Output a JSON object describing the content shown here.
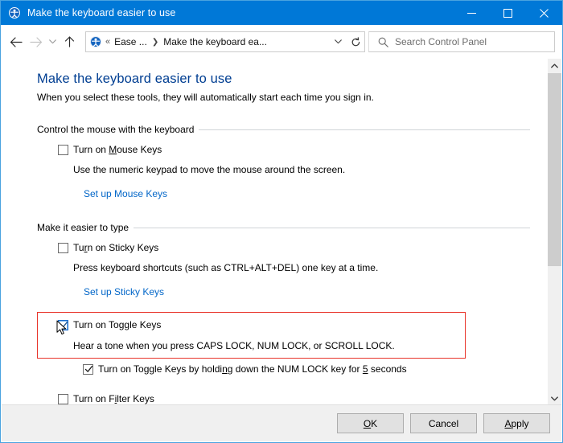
{
  "window": {
    "title": "Make the keyboard easier to use",
    "title_icon": "ease-of-access-icon",
    "minimize_label": "─",
    "maximize_label": "□",
    "close_label": "✕",
    "accent_color": "#0078d7",
    "border_color": "#4aa3e0"
  },
  "navigation": {
    "back_icon": "back-arrow-icon",
    "forward_icon": "forward-arrow-icon",
    "recent_icon": "chevron-down-icon",
    "up_icon": "up-arrow-icon",
    "address": {
      "icon": "ease-of-access-icon",
      "overflow_chevrons": "«",
      "crumbs": [
        "Ease ...",
        "Make the keyboard ea..."
      ],
      "separator": "❯",
      "dropdown_icon": "chevron-down-icon",
      "refresh_icon": "refresh-icon"
    },
    "search": {
      "icon": "search-icon",
      "placeholder": "Search Control Panel",
      "value": ""
    }
  },
  "page": {
    "heading": "Make the keyboard easier to use",
    "subheading": "When you select these tools, they will automatically start each time you sign in.",
    "heading_color": "#003e92",
    "link_color": "#0266c8"
  },
  "sections": [
    {
      "title": "Control the mouse with the keyboard",
      "checkbox": {
        "label_pre": "Turn on ",
        "label_accel": "M",
        "label_post": "ouse Keys",
        "checked": false
      },
      "description": "Use the numeric keypad to move the mouse around the screen.",
      "link": "Set up Mouse Keys"
    },
    {
      "title": "Make it easier to type",
      "checkbox": {
        "label_pre": "Tu",
        "label_accel": "r",
        "label_post": "n on Sticky Keys",
        "checked": false
      },
      "description": "Press keyboard shortcuts (such as CTRL+ALT+DEL) one key at a time.",
      "link": "Set up Sticky Keys"
    }
  ],
  "toggle_keys": {
    "checkbox": {
      "label_pre": "Turn on To",
      "label_accel": "g",
      "label_post": "gle Keys",
      "checked": true,
      "focused": true
    },
    "description": "Hear a tone when you press CAPS LOCK, NUM LOCK, or SCROLL LOCK.",
    "sub_checkbox": {
      "label_pre": "Turn on Toggle Keys by holdi",
      "label_accel": "n",
      "label_mid": "g down the NUM LOCK key for ",
      "label_accel2": "5",
      "label_post": " seconds",
      "checked": true
    },
    "highlight_color": "#e8342a"
  },
  "filter_keys": {
    "checkbox": {
      "label_pre": "Turn on F",
      "label_accel": "i",
      "label_post": "lter Keys",
      "checked": false
    }
  },
  "scrollbar": {
    "up_icon": "scroll-up-arrow-icon",
    "down_icon": "scroll-down-arrow-icon",
    "thumb_name": "scroll-thumb"
  },
  "buttons": {
    "ok": {
      "pre": "",
      "accel": "O",
      "post": "K"
    },
    "cancel": {
      "pre": "Cancel",
      "accel": "",
      "post": ""
    },
    "apply": {
      "pre": "",
      "accel": "A",
      "post": "pply"
    }
  }
}
